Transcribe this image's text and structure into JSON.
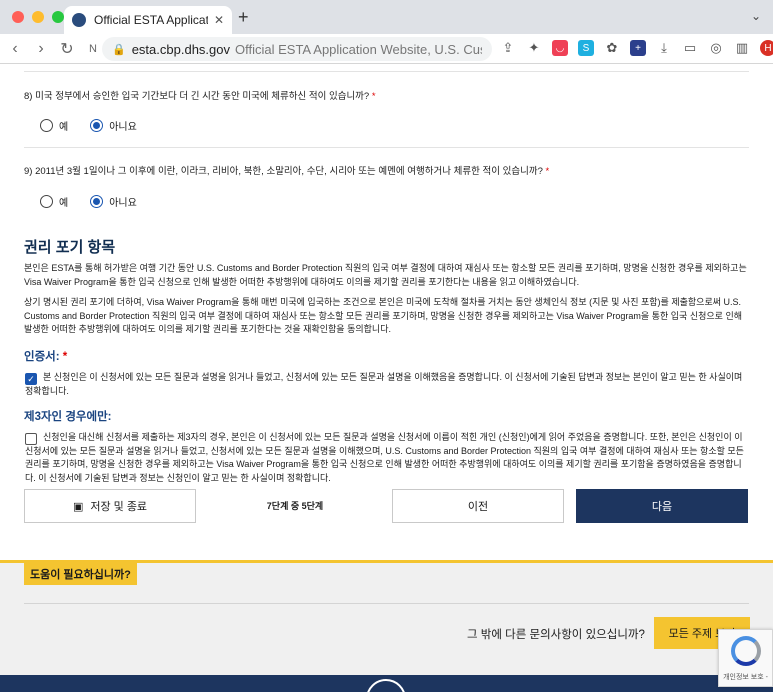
{
  "browser": {
    "tab_title": "Official ESTA Application Website",
    "url_host": "esta.cbp.dhs.gov",
    "url_title": "Official ESTA Application Website, U.S. Customs"
  },
  "questions": [
    {
      "number_text": "8) 미국 정부에서 승인한 입국 기간보다 더 긴 시간 동안 미국에 체류하신 적이 있습니까?",
      "required": "*",
      "option_yes": "예",
      "option_no": "아니요",
      "selected": "no"
    },
    {
      "number_text": "9) 2011년 3월 1일이나 그 이후에 이란, 이라크, 리비아, 북한, 소말리아, 수단, 시리아 또는 예멘에 여행하거나 체류한 적이 있습니까?",
      "required": "*",
      "option_yes": "예",
      "option_no": "아니요",
      "selected": "no"
    }
  ],
  "waiver": {
    "heading": "권리 포기 항목",
    "para1": "본인은 ESTA를 통해 허가받은 여행 기간 동안 U.S. Customs and Border Protection 직원의 입국 여부 결정에 대하여 재심사 또는 항소할 모든 권리를 포기하며, 망명을 신청한 경우를 제외하고는 Visa Waiver Program을 통한 입국 신청으로 인해 발생한 어떠한 추방행위에 대하여도 이의를 제기할 권리를 포기한다는 내용을 읽고 이해하였습니다.",
    "para2": "상기 명시된 권리 포기에 더하여, Visa Waiver Program을 통해 매번 미국에 입국하는 조건으로 본인은 미국에 도착해 절차를 거치는 동안 생체인식 정보 (지문 및 사진 포함)를 제출함으로써 U.S. Customs and Border Protection 직원의 입국 여부 결정에 대하여 재심사 또는 항소할 모든 권리를 포기하며, 망명을 신청한 경우를 제외하고는 Visa Waiver Program을 통한 입국 신청으로 인해 발생한 어떠한 추방행위에 대하여도 이의를 제기할 권리를 포기한다는 것을 재확인함을 동의합니다."
  },
  "certification": {
    "heading": "인증서:",
    "required": "*",
    "checked": true,
    "text": "본 신청인은 이 신청서에 있는 모든 질문과 설명을 읽거나 들었고, 신청서에 있는 모든 질문과 설명을 이해했음을 증명합니다. 이 신청서에 기술된 답변과 정보는 본인이 알고 믿는 한 사실이며 정확합니다."
  },
  "third_party": {
    "heading": "제3자인 경우에만:",
    "checked": false,
    "text": "신청인을 대신해 신청서를 제출하는 제3자의 경우, 본인은 이 신청서에 있는 모든 질문과 설명을 신청서에 이름이 적힌 개인 (신청인)에게 읽어 주었음을 증명합니다. 또한, 본인은 신청인이 이 신청서에 있는 모든 질문과 설명을 읽거나 들었고, 신청서에 있는 모든 질문과 설명을 이해했으며, U.S. Customs and Border Protection 직원의 입국 여부 결정에 대하여 재심사 또는 항소할 모든 권리를 포기하며, 망명을 신청한 경우를 제외하고는 Visa Waiver Program을 통한 입국 신청으로 인해 발생한 어떠한 추방행위에 대하여도 이의를 제기할 권리를 포기함을 증명하였음을 증명합니다. 이 신청서에 기술된 답변과 정보는 신청인이 알고 믿는 한 사실이며 정확합니다."
  },
  "nav": {
    "save_label": "저장 및 종료",
    "step_text": "7단계 중 5단계",
    "prev_label": "이전",
    "next_label": "다음"
  },
  "footer": {
    "help_label": "도움이 필요하십니까?",
    "other_question": "그 밖에 다른 문의사항이 있으십니까?",
    "all_topics_label": "모든 주제 보기",
    "recaptcha_text": "개인정보 보호 -"
  },
  "colors": {
    "navy": "#1d355f",
    "accent_yellow": "#f4c430",
    "radio_blue": "#1a56b0",
    "required_red": "#dd0000"
  }
}
